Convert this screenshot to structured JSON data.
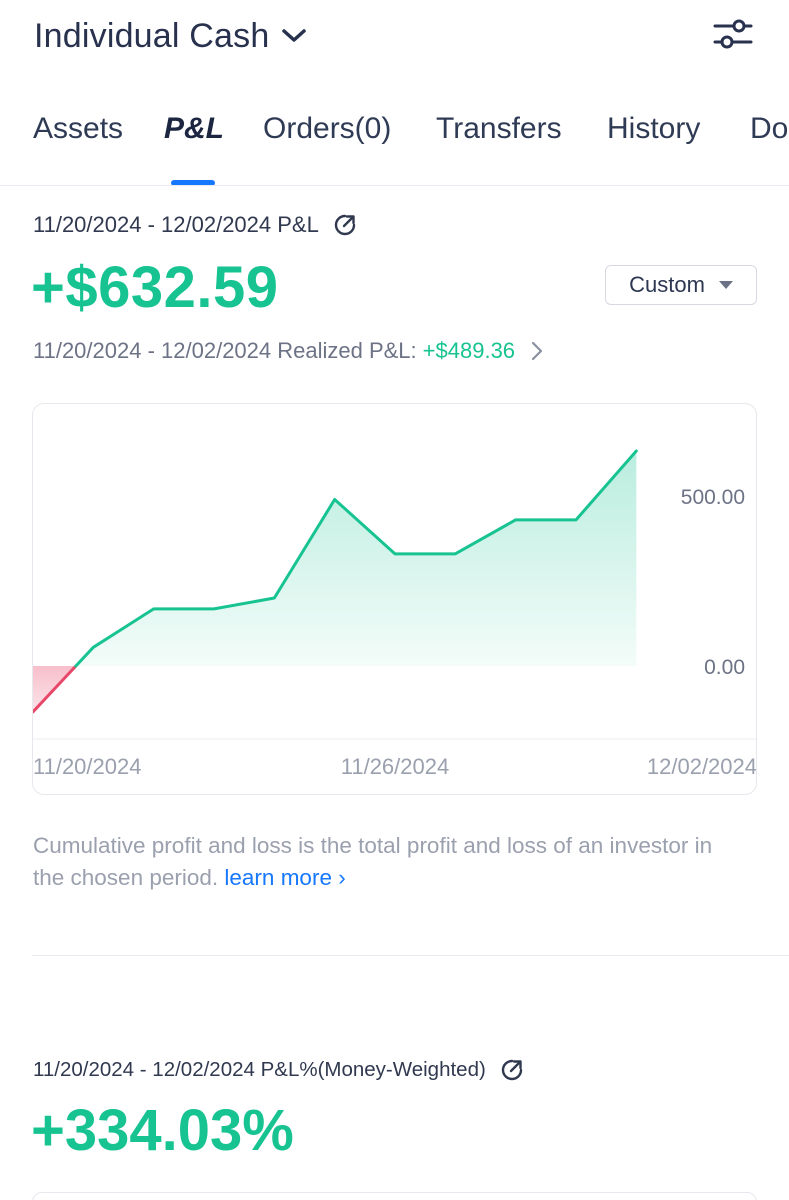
{
  "header": {
    "account_title": "Individual Cash"
  },
  "tabs": [
    {
      "label": "Assets"
    },
    {
      "label": "P&L"
    },
    {
      "label": "Orders(0)"
    },
    {
      "label": "Transfers"
    },
    {
      "label": "History"
    },
    {
      "label": "Do"
    }
  ],
  "active_tab": "P&L",
  "pnl": {
    "range_label": "11/20/2024 - 12/02/2024 P&L",
    "value": "+$632.59",
    "period_selector": "Custom",
    "realized_label": "11/20/2024 - 12/02/2024 Realized P&L:",
    "realized_value": "+$489.36"
  },
  "footnote": {
    "text": "Cumulative profit and loss is the total profit and loss of an investor in the chosen period.",
    "link": "learn more"
  },
  "pnl_pct": {
    "range_label": "11/20/2024 - 12/02/2024 P&L%(Money-Weighted)",
    "value": "+334.03%"
  },
  "colors": {
    "positive": "#17c391",
    "negative": "#e8476a",
    "accent": "#1677ff"
  },
  "icons": {
    "account": "chevron-down-icon",
    "settings": "sliders-icon",
    "share": "share-icon",
    "realized": "chevron-right-icon"
  },
  "chart_data": {
    "type": "area",
    "x": [
      "11/20/2024",
      "11/21/2024",
      "11/22/2024",
      "11/23/2024",
      "11/24/2024",
      "11/25/2024",
      "11/26/2024",
      "11/27/2024",
      "11/28/2024",
      "11/29/2024",
      "11/30/2024",
      "12/01/2024",
      "12/02/2024"
    ],
    "values": [
      -135,
      55,
      168,
      168,
      200,
      490,
      330,
      330,
      430,
      430,
      632.59,
      null,
      null
    ],
    "series": [
      {
        "values": [
          -135,
          55,
          168,
          168,
          200,
          490,
          330,
          330,
          430,
          430,
          632.59
        ]
      }
    ],
    "x_ticks": [
      "11/20/2024",
      "11/26/2024",
      "12/02/2024"
    ],
    "y_ticks": [
      "500.00",
      "0.00"
    ],
    "y_tick_values": [
      500,
      0
    ],
    "ylim": [
      -135,
      632.59
    ],
    "title": "",
    "xlabel": "",
    "ylabel": "",
    "grid": false
  }
}
